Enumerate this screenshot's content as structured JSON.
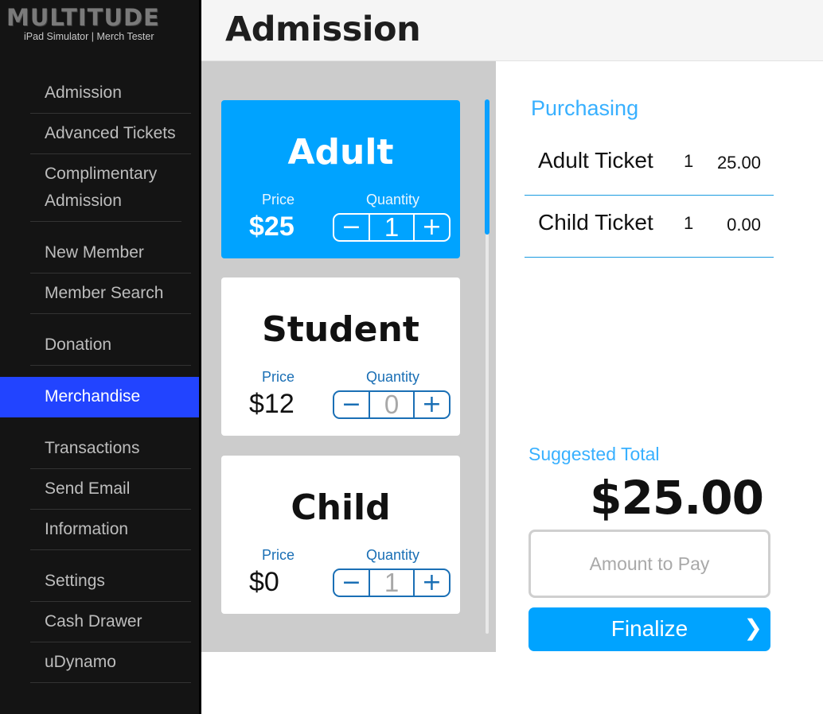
{
  "brand": {
    "logo": "MULTITUDE",
    "subtitle": "iPad Simulator | Merch Tester"
  },
  "nav": {
    "items": [
      {
        "label": "Admission"
      },
      {
        "label": "Advanced Tickets"
      },
      {
        "label": "Complimentary Admission"
      },
      {
        "label": "New Member"
      },
      {
        "label": "Member Search"
      },
      {
        "label": "Donation"
      },
      {
        "label": "Merchandise",
        "active": true
      },
      {
        "label": "Transactions"
      },
      {
        "label": "Send Email"
      },
      {
        "label": "Information"
      },
      {
        "label": "Settings"
      },
      {
        "label": "Cash Drawer"
      },
      {
        "label": "uDynamo"
      }
    ]
  },
  "header": {
    "title": "Admission"
  },
  "products": {
    "price_label": "Price",
    "quantity_label": "Quantity",
    "items": [
      {
        "name": "Adult",
        "price": "$25",
        "quantity": "1",
        "selected": true
      },
      {
        "name": "Student",
        "price": "$12",
        "quantity": "0",
        "selected": false
      },
      {
        "name": "Child",
        "price": "$0",
        "quantity": "1",
        "selected": false
      }
    ],
    "decrement": "−",
    "increment": "+"
  },
  "cart": {
    "heading": "Purchasing",
    "rows": [
      {
        "name": "Adult Ticket",
        "qty": "1",
        "amount": "25.00"
      },
      {
        "name": "Child Ticket",
        "qty": "1",
        "amount": "0.00"
      }
    ]
  },
  "total": {
    "label": "Suggested Total",
    "value": "$25.00"
  },
  "payment": {
    "placeholder": "Amount to Pay"
  },
  "finalize": {
    "label": "Finalize",
    "icon": "❯"
  },
  "colors": {
    "accent": "#00a3ff",
    "active_nav": "#2244ff",
    "sidebar": "#141414",
    "label_blue": "#38b0ff"
  },
  "icons": {
    "finalize_icon": "chevron-right-icon"
  }
}
